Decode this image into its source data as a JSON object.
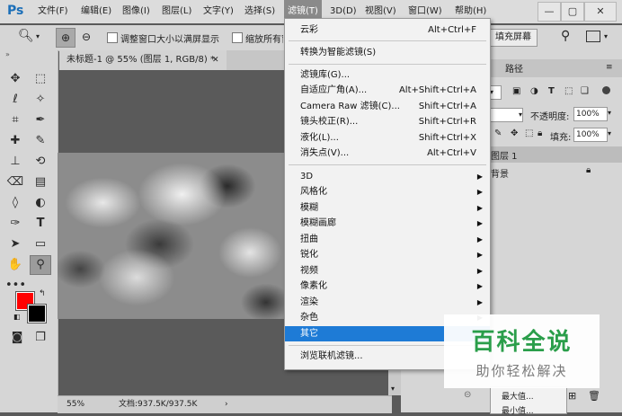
{
  "app": {
    "logo": "Ps"
  },
  "menubar": {
    "items": [
      "文件(F)",
      "编辑(E)",
      "图像(I)",
      "图层(L)",
      "文字(Y)",
      "选择(S)",
      "滤镜(T)",
      "3D(D)",
      "视图(V)",
      "窗口(W)",
      "帮助(H)"
    ],
    "active_index": 6
  },
  "window_controls": {
    "minimize": "—",
    "restore": "▢",
    "close": "✕"
  },
  "options_bar": {
    "resize_checkbox_label": "调整窗口大小以满屏显示",
    "zoom_all_label": "缩放所有窗",
    "fill_screen_button": "填充屏幕"
  },
  "document": {
    "tab_title": "未标题-1 @ 55% (图层 1, RGB/8) *",
    "tab_close": "✕",
    "zoom": "55%",
    "doc_info": "文档:937.5K/937.5K"
  },
  "filter_menu": {
    "groups": [
      [
        {
          "label": "云彩",
          "shortcut": "Alt+Ctrl+F"
        }
      ],
      [
        {
          "label": "转换为智能滤镜(S)",
          "shortcut": ""
        }
      ],
      [
        {
          "label": "滤镜库(G)...",
          "shortcut": ""
        },
        {
          "label": "自适应广角(A)...",
          "shortcut": "Alt+Shift+Ctrl+A"
        },
        {
          "label": "Camera Raw 滤镜(C)...",
          "shortcut": "Shift+Ctrl+A"
        },
        {
          "label": "镜头校正(R)...",
          "shortcut": "Shift+Ctrl+R"
        },
        {
          "label": "液化(L)...",
          "shortcut": "Shift+Ctrl+X"
        },
        {
          "label": "消失点(V)...",
          "shortcut": "Alt+Ctrl+V"
        }
      ],
      [
        {
          "label": "3D",
          "submenu": true
        },
        {
          "label": "风格化",
          "submenu": true
        },
        {
          "label": "模糊",
          "submenu": true
        },
        {
          "label": "模糊画廊",
          "submenu": true
        },
        {
          "label": "扭曲",
          "submenu": true
        },
        {
          "label": "锐化",
          "submenu": true
        },
        {
          "label": "视频",
          "submenu": true
        },
        {
          "label": "像素化",
          "submenu": true
        },
        {
          "label": "渲染",
          "submenu": true
        },
        {
          "label": "杂色",
          "submenu": true
        },
        {
          "label": "其它",
          "submenu": true,
          "highlighted": true
        }
      ],
      [
        {
          "label": "浏览联机滤镜...",
          "shortcut": ""
        }
      ]
    ]
  },
  "panels": {
    "paths_tab": "路径",
    "opacity_label": "不透明度:",
    "opacity_value": "100%",
    "fill_label": "填充:",
    "fill_value": "100%",
    "layers": [
      {
        "name": "图层 1",
        "locked": false
      },
      {
        "name": "背景",
        "locked": true
      }
    ]
  },
  "submenu_other": {
    "items": [
      "最大值...",
      "最小值..."
    ]
  },
  "watermark": {
    "title": "百科全说",
    "subtitle": "助你轻松解决"
  },
  "colors": {
    "foreground": "#ff0000",
    "background": "#000000",
    "accent": "#1e7bd6"
  }
}
